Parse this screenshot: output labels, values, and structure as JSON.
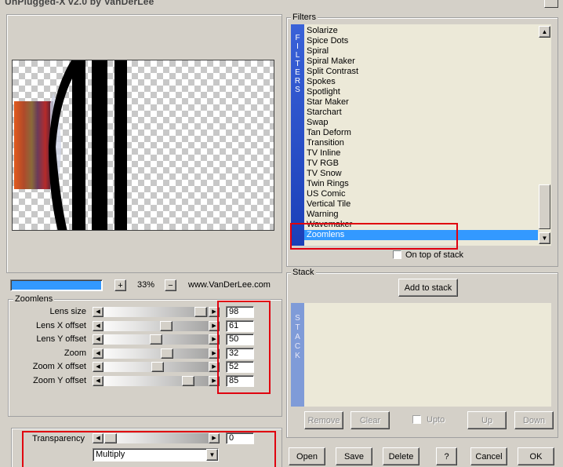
{
  "window": {
    "title": "UnPlugged-X v2.0 by VanDerLee"
  },
  "preview": {
    "zoom_in": "+",
    "zoom_value": "33%",
    "zoom_out": "−",
    "website": "www.VanDerLee.com"
  },
  "filters": {
    "label": "Filters",
    "sidebar_letters": [
      "F",
      "I",
      "L",
      "T",
      "E",
      "R",
      "S"
    ],
    "items": [
      "Solarize",
      "Spice Dots",
      "Spiral",
      "Spiral Maker",
      "Split Contrast",
      "Spokes",
      "Spotlight",
      "Star Maker",
      "Starchart",
      "Swap",
      "Tan Deform",
      "Transition",
      "TV Inline",
      "TV RGB",
      "TV Snow",
      "Twin Rings",
      "US Comic",
      "Vertical Tile",
      "Warning",
      "Wavemaker",
      "Zoomlens"
    ],
    "selected": "Zoomlens",
    "on_top_of_stack": "On top of stack"
  },
  "zoomlens": {
    "label": "Zoomlens",
    "sliders": [
      {
        "label": "Lens size",
        "value": "98",
        "level": 0.98
      },
      {
        "label": "Lens X offset",
        "value": "61",
        "level": 0.61
      },
      {
        "label": "Lens Y offset",
        "value": "50",
        "level": 0.5
      },
      {
        "label": "Zoom",
        "value": "32",
        "level": 0.62
      },
      {
        "label": "Zoom X offset",
        "value": "52",
        "level": 0.52
      },
      {
        "label": "Zoom Y offset",
        "value": "85",
        "level": 0.85
      }
    ]
  },
  "transparency": {
    "label": "Transparency",
    "value": "0",
    "level": 0.0,
    "blend_mode": "Multiply"
  },
  "stack": {
    "label": "Stack",
    "add_to_stack": "Add to stack",
    "sidebar_letters": [
      "S",
      "T",
      "A",
      "C",
      "K"
    ],
    "remove": "Remove",
    "clear": "Clear",
    "upto": "Upto",
    "up": "Up",
    "down": "Down"
  },
  "footer": {
    "open": "Open",
    "save": "Save",
    "delete": "Delete",
    "help": "?",
    "cancel": "Cancel",
    "ok": "OK"
  },
  "colors": {
    "selection": "#3399ff",
    "highlight_box": "#e0000f",
    "sidebar": "#1b3fb8",
    "stack_sidebar": "#7f9bd8"
  }
}
